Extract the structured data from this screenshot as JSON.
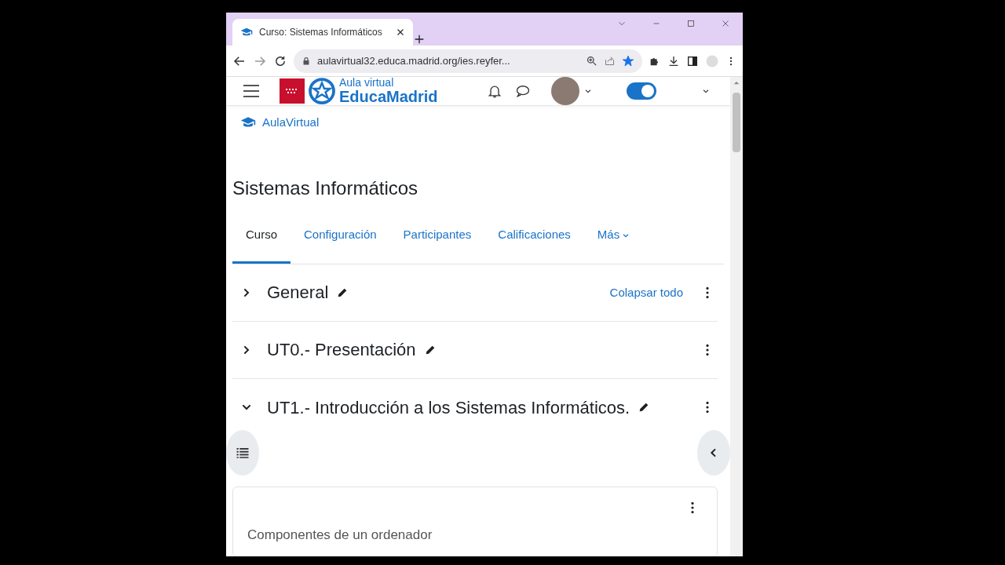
{
  "browser": {
    "tabs": [
      {
        "title": "Curso: Sistemas Informáticos",
        "selected": true
      }
    ],
    "url": "aulavirtual32.educa.madrid.org/ies.reyfer...",
    "bookmarked": true
  },
  "header": {
    "logo_small": "Aula virtual",
    "logo_big": "EducaMadrid",
    "edit_mode": true
  },
  "breadcrumb": "AulaVirtual",
  "course_title": "Sistemas Informáticos",
  "nav": [
    {
      "label": "Curso",
      "selected": true,
      "kind": "link"
    },
    {
      "label": "Configuración",
      "selected": false,
      "kind": "link"
    },
    {
      "label": "Participantes",
      "selected": false,
      "kind": "link"
    },
    {
      "label": "Calificaciones",
      "selected": false,
      "kind": "link"
    },
    {
      "label": "Más",
      "selected": false,
      "kind": "dropdown"
    }
  ],
  "collapse_all": "Colapsar todo",
  "sections": [
    {
      "title": "General",
      "expanded": false
    },
    {
      "title": "UT0.- Presentación",
      "expanded": false
    },
    {
      "title": "UT1.- Introducción a los Sistemas Informáticos.",
      "expanded": true
    }
  ],
  "activity": {
    "title": "Componentes de un ordenador"
  }
}
